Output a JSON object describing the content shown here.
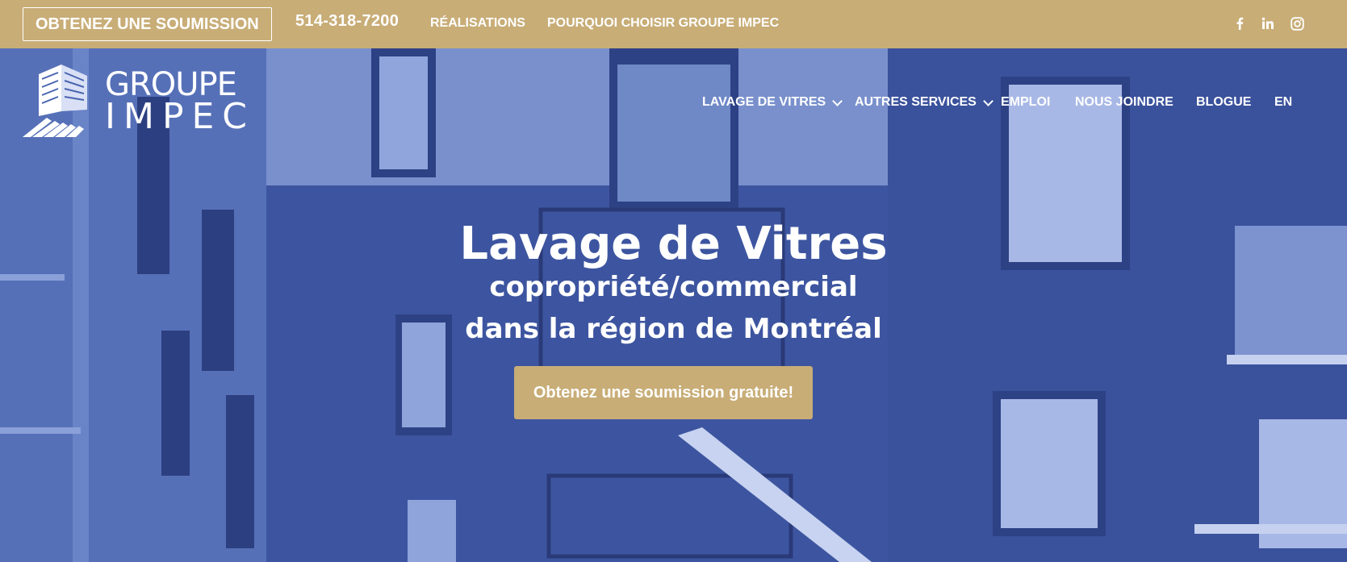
{
  "topbar": {
    "quote_label": "OBTENEZ UNE SOUMISSION",
    "phone": "514-318-7200",
    "links": [
      "RÉALISATIONS",
      "POURQUOI CHOISIR GROUPE IMPEC"
    ],
    "social": [
      {
        "icon": "facebook-icon",
        "glyph": "f"
      },
      {
        "icon": "linkedin-icon",
        "glyph": "in"
      },
      {
        "icon": "instagram-icon",
        "glyph": ""
      }
    ],
    "color": "#c8ad77"
  },
  "logo": {
    "line1": "GROUPE",
    "line2": "IMPEC"
  },
  "nav": {
    "items": [
      {
        "label": "LAVAGE DE VITRES",
        "has_dropdown": true
      },
      {
        "label": "AUTRES SERVICES",
        "has_dropdown": true
      },
      {
        "label": "EMPLOI",
        "has_dropdown": false
      },
      {
        "label": "NOUS JOINDRE",
        "has_dropdown": false
      },
      {
        "label": "BLOGUE",
        "has_dropdown": false
      },
      {
        "label": "EN",
        "has_dropdown": false
      }
    ]
  },
  "hero": {
    "title": "Lavage de Vitres",
    "subtitle1": "copropriété/commercial",
    "subtitle2": "dans la région de Montréal",
    "cta_label": "Obtenez une soumission gratuite!",
    "overlay_color": "#4a64b0"
  }
}
